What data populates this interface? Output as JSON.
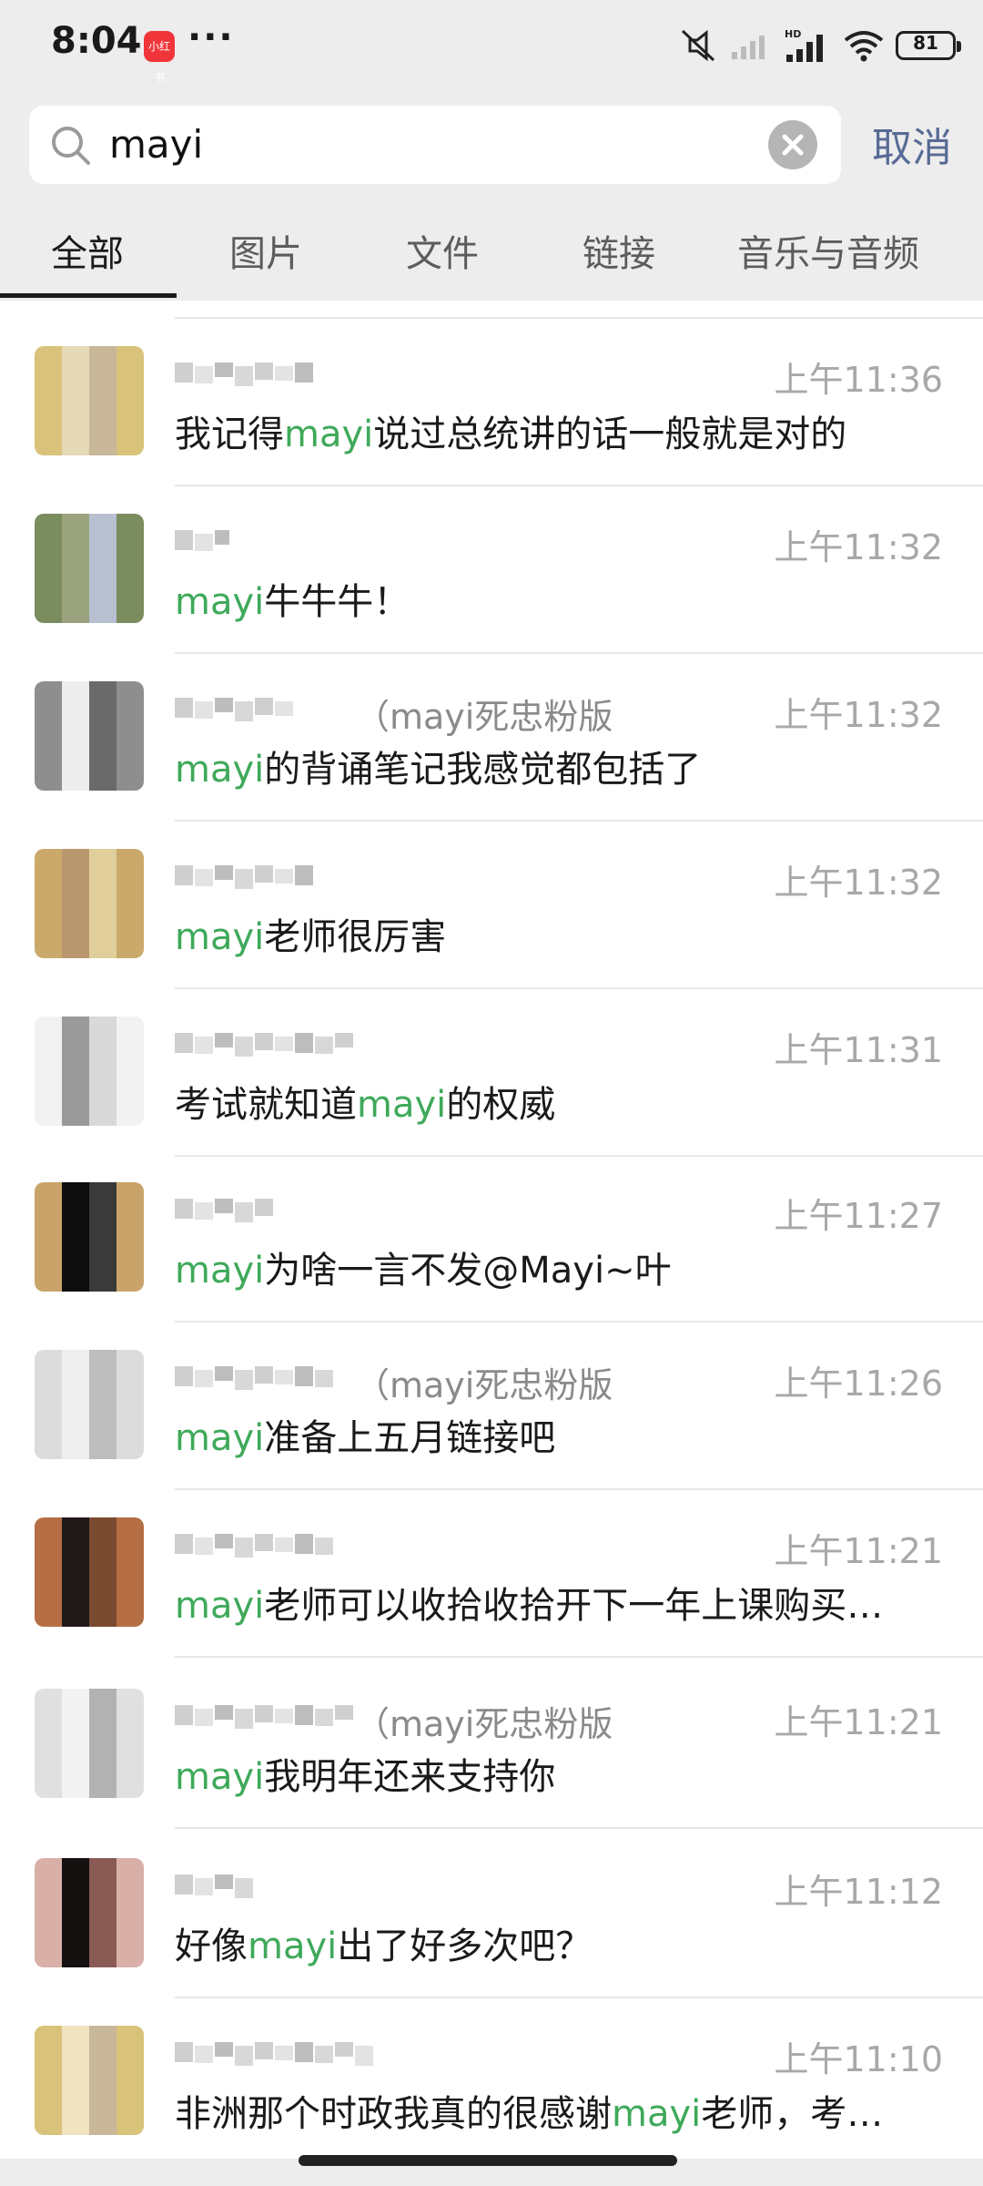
{
  "status_bar": {
    "time": "8:04",
    "app_badge": "小红书",
    "dots": "···",
    "battery": "81"
  },
  "search": {
    "query": "mayi",
    "cancel_label": "取消"
  },
  "tabs": [
    {
      "label": "全部",
      "active": true
    },
    {
      "label": "图片",
      "active": false
    },
    {
      "label": "文件",
      "active": false
    },
    {
      "label": "链接",
      "active": false
    },
    {
      "label": "音乐与音频",
      "active": false
    }
  ],
  "results": [
    {
      "time": "上午11:36",
      "sender_suffix": "",
      "parts": [
        {
          "t": "我记得",
          "h": false
        },
        {
          "t": "mayi",
          "h": true
        },
        {
          "t": "说过总统讲的话一般就是对的",
          "h": false
        }
      ]
    },
    {
      "time": "上午11:32",
      "sender_suffix": "",
      "parts": [
        {
          "t": "mayi",
          "h": true
        },
        {
          "t": "牛牛牛！",
          "h": false
        }
      ]
    },
    {
      "time": "上午11:32",
      "sender_suffix": "（mayi死忠粉版",
      "parts": [
        {
          "t": "mayi",
          "h": true
        },
        {
          "t": "的背诵笔记我感觉都包括了",
          "h": false
        }
      ]
    },
    {
      "time": "上午11:32",
      "sender_suffix": "",
      "parts": [
        {
          "t": "mayi",
          "h": true
        },
        {
          "t": "老师很厉害",
          "h": false
        }
      ]
    },
    {
      "time": "上午11:31",
      "sender_suffix": "",
      "parts": [
        {
          "t": "考试就知道",
          "h": false
        },
        {
          "t": "mayi",
          "h": true
        },
        {
          "t": "的权威",
          "h": false
        }
      ]
    },
    {
      "time": "上午11:27",
      "sender_suffix": "",
      "parts": [
        {
          "t": "mayi",
          "h": true
        },
        {
          "t": "为啥一言不发@Mayi~叶",
          "h": false
        }
      ]
    },
    {
      "time": "上午11:26",
      "sender_suffix": "（mayi死忠粉版",
      "parts": [
        {
          "t": "mayi",
          "h": true
        },
        {
          "t": "准备上五月链接吧",
          "h": false
        }
      ]
    },
    {
      "time": "上午11:21",
      "sender_suffix": "",
      "parts": [
        {
          "t": "mayi",
          "h": true
        },
        {
          "t": "老师可以收拾收拾开下一年上课购买…",
          "h": false
        }
      ]
    },
    {
      "time": "上午11:21",
      "sender_suffix": "（mayi死忠粉版",
      "parts": [
        {
          "t": "mayi",
          "h": true
        },
        {
          "t": "我明年还来支持你",
          "h": false
        }
      ]
    },
    {
      "time": "上午11:12",
      "sender_suffix": "",
      "parts": [
        {
          "t": "好像",
          "h": false
        },
        {
          "t": "mayi",
          "h": true
        },
        {
          "t": "出了好多次吧？",
          "h": false
        }
      ]
    },
    {
      "time": "上午11:10",
      "sender_suffix": "",
      "parts": [
        {
          "t": "非洲那个时政我真的很感谢",
          "h": false
        },
        {
          "t": "mayi",
          "h": true
        },
        {
          "t": "老师，考…",
          "h": false
        }
      ]
    }
  ],
  "colors": {
    "highlight": "#3fa95a",
    "link": "#576b95",
    "time": "#a8a8a8"
  }
}
